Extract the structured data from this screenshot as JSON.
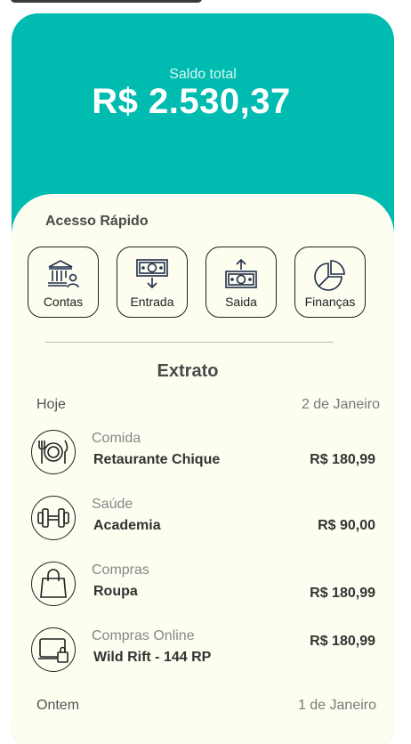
{
  "balance": {
    "label": "Saldo total",
    "value": "R$ 2.530,37"
  },
  "quick_access": {
    "title": "Acesso Rápido",
    "items": [
      {
        "label": "Contas",
        "icon": "bank-icon"
      },
      {
        "label": "Entrada",
        "icon": "money-in-icon"
      },
      {
        "label": "Saida",
        "icon": "money-out-icon"
      },
      {
        "label": "Finanças",
        "icon": "pie-chart-icon"
      }
    ]
  },
  "statement": {
    "title": "Extrato",
    "groups": [
      {
        "day": "Hoje",
        "date": "2 de Janeiro",
        "transactions": [
          {
            "category": "Comida",
            "name": "Retaurante Chique",
            "amount": "R$ 180,99",
            "icon": "plate-cutlery-icon"
          },
          {
            "category": "Saúde",
            "name": "Academia",
            "amount": "R$ 90,00",
            "icon": "dumbbell-icon"
          },
          {
            "category": "Compras",
            "name": "Roupa",
            "amount": "R$ 180,99",
            "icon": "shopping-bag-icon"
          },
          {
            "category": "Compras Online",
            "name": "Wild Rift - 144 RP",
            "amount": "R$ 180,99",
            "icon": "laptop-bag-icon"
          }
        ]
      },
      {
        "day": "Ontem",
        "date": "1 de Janeiro",
        "transactions": []
      }
    ]
  },
  "colors": {
    "header": "#00bcb0",
    "panel": "#fdfdf0",
    "text": "#333333"
  }
}
